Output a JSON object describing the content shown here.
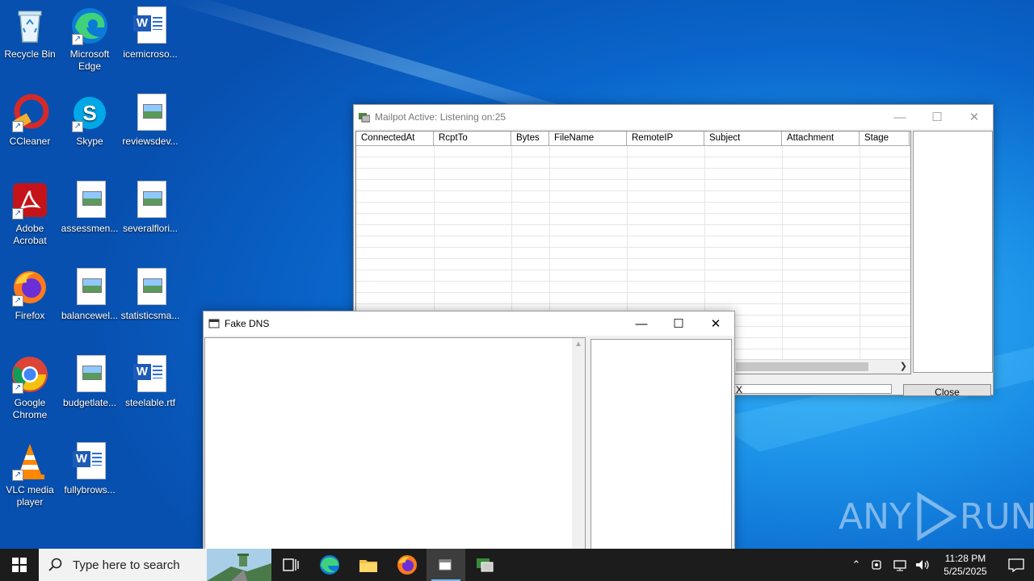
{
  "desktop": {
    "icons": [
      {
        "label": "Recycle Bin"
      },
      {
        "label": "Microsoft Edge"
      },
      {
        "label": "icemicroso..."
      },
      {
        "label": "CCleaner"
      },
      {
        "label": "Skype"
      },
      {
        "label": "reviewsdev..."
      },
      {
        "label": "Adobe Acrobat"
      },
      {
        "label": "assessmen..."
      },
      {
        "label": "severalflori..."
      },
      {
        "label": "Firefox"
      },
      {
        "label": "balancewel..."
      },
      {
        "label": "statisticsma..."
      },
      {
        "label": "Google Chrome"
      },
      {
        "label": "budgetlate..."
      },
      {
        "label": "steelable.rtf"
      },
      {
        "label": "VLC media player"
      },
      {
        "label": "fullybrows..."
      }
    ]
  },
  "mailpot": {
    "title": "Mailpot Active: Listening on:25",
    "columns": [
      "ConnectedAt",
      "RcptTo",
      "Bytes",
      "FileName",
      "RemoteIP",
      "Subject",
      "Attachment",
      "Stage"
    ],
    "close_label": "Close",
    "partial_text": "X"
  },
  "fakedns": {
    "title": "Fake DNS"
  },
  "watermark": {
    "text_left": "ANY",
    "text_right": "RUN"
  },
  "taskbar": {
    "search_placeholder": "Type here to search",
    "time": "11:28 PM",
    "date": "5/25/2025"
  },
  "colors": {
    "accent": "#0078d7",
    "taskbar": "#1c1c1c"
  }
}
